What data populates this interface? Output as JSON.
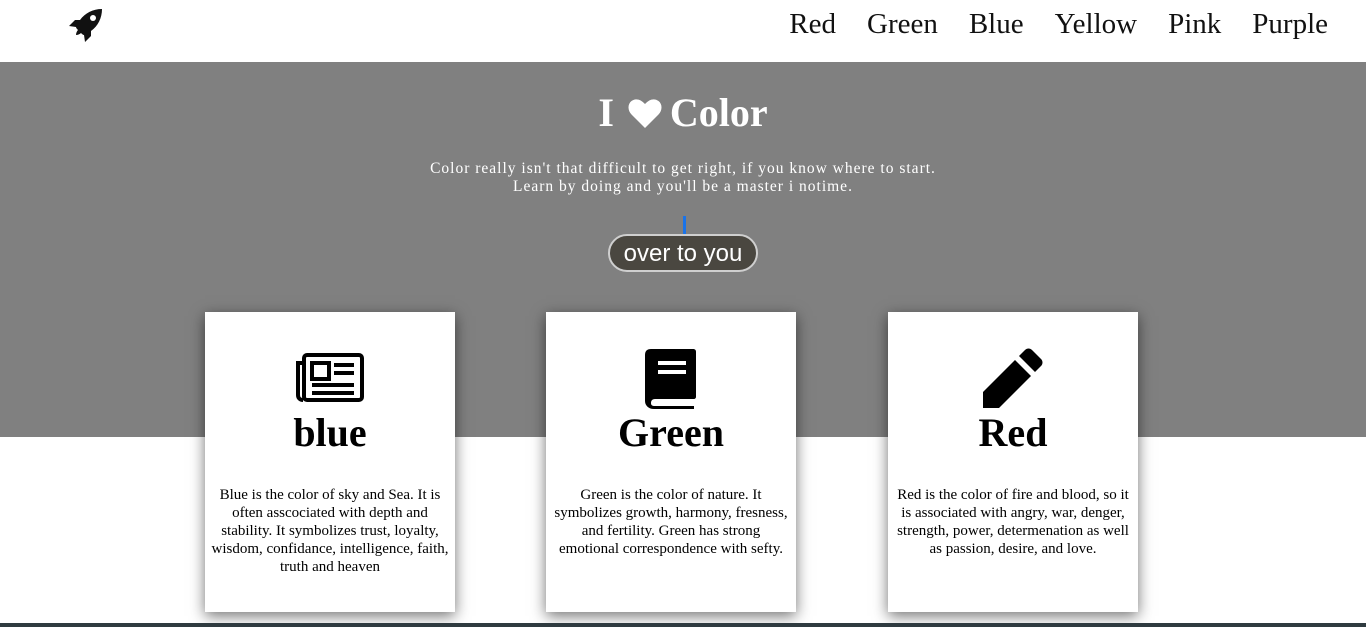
{
  "nav": {
    "logo_icon": "rocket-icon",
    "items": [
      {
        "label": "Red"
      },
      {
        "label": "Green"
      },
      {
        "label": "Blue"
      },
      {
        "label": "Yellow"
      },
      {
        "label": "Pink"
      },
      {
        "label": "Purple"
      }
    ]
  },
  "hero": {
    "title_before": "I",
    "title_icon": "heart-icon",
    "title_after": "Color",
    "text_line1": "Color really isn't that difficult to get right, if you know where to start.",
    "text_line2": "Learn by doing and you'll be a master i notime.",
    "cta_label": "over to you",
    "background_color": "#808080"
  },
  "cards": [
    {
      "icon": "newspaper-icon",
      "title": "blue",
      "text": "Blue is the color of sky and Sea. It is often asscociated with depth and stability. It symbolizes trust, loyalty, wisdom, confidance, intelligence, faith, truth and heaven"
    },
    {
      "icon": "book-icon",
      "title": "Green",
      "text": "Green is the color of nature. It symbolizes growth, harmony, fresness, and fertility. Green has strong emotional correspondence with sefty."
    },
    {
      "icon": "pencil-icon",
      "title": "Red",
      "text": "Red is the color of fire and blood, so it is associated with angry, war, denger, strength, power, determenation as well as passion, desire, and love."
    }
  ]
}
